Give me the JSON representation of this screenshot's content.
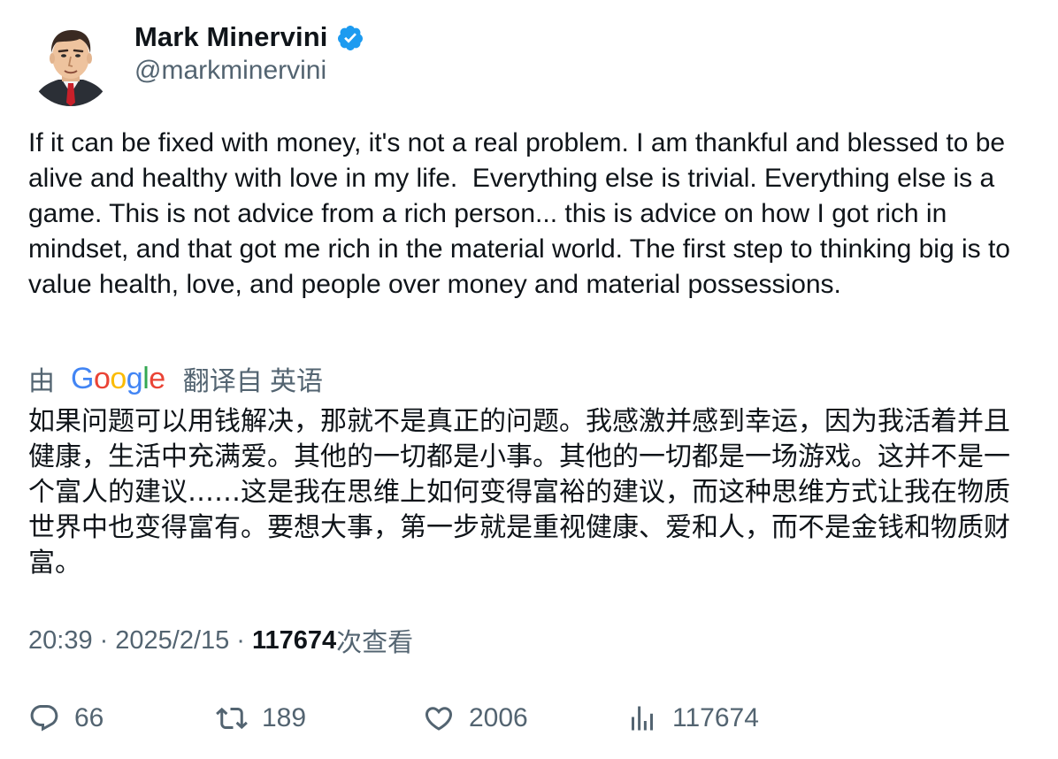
{
  "author": {
    "display_name": "Mark Minervini",
    "handle": "@markminervini",
    "verified": true,
    "verified_color": "#1d9bf0"
  },
  "tweet": {
    "text": "If it can be fixed with money, it's not a real problem. I am thankful and blessed to be alive and healthy with love in my life.  Everything else is trivial. Everything else is a game. This is not advice from a rich person... this is advice on how I got rich in mindset, and that got me rich in the material world. The first step to thinking big is to value health, love, and people over money and material possessions."
  },
  "translation": {
    "by_label": "由",
    "provider": "Google",
    "from_label": "翻译自 英语",
    "text": "如果问题可以用钱解决，那就不是真正的问题。我感激并感到幸运，因为我活着并且健康，生活中充满爱。其他的一切都是小事。其他的一切都是一场游戏。这并不是一个富人的建议……这是我在思维上如何变得富裕的建议，而这种思维方式让我在物质世界中也变得富有。要想大事，第一步就是重视健康、爱和人，而不是金钱和物质财富。"
  },
  "meta": {
    "time": "20:39",
    "separator": "·",
    "date": "2025/2/15",
    "views_count": "117674",
    "views_label": "次查看"
  },
  "actions": {
    "replies": "66",
    "retweets": "189",
    "likes": "2006",
    "views": "117674"
  },
  "colors": {
    "text_primary": "#0f1419",
    "text_secondary": "#536471",
    "google_blue": "#4285f4",
    "google_red": "#ea4335",
    "google_yellow": "#fbbc05",
    "google_green": "#34a853"
  }
}
